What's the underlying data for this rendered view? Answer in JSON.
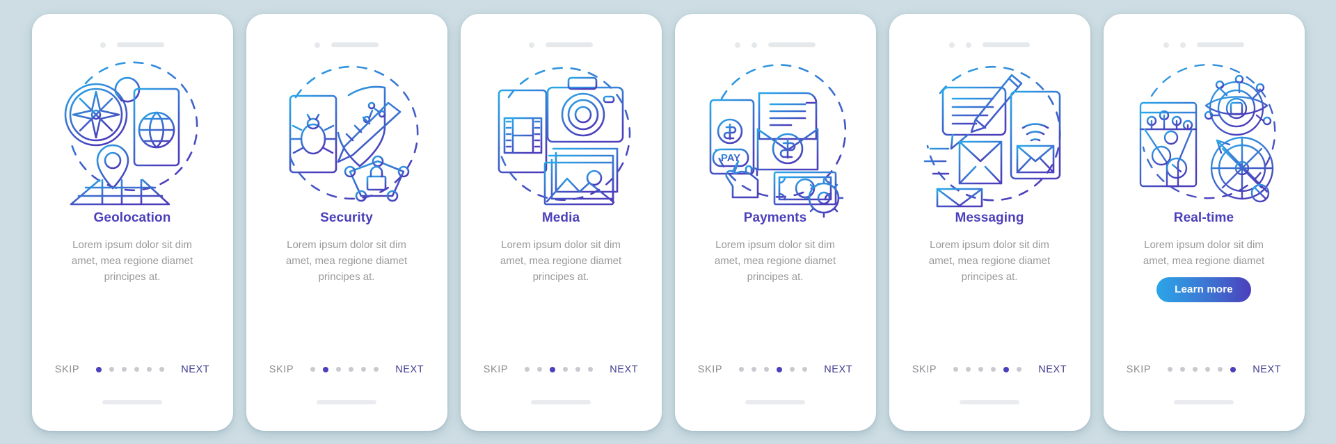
{
  "background_color": "#cddde3",
  "theme": {
    "title_color": "#4b3fbb",
    "desc_color": "#9a9a9d",
    "skip_color": "#8d8d92",
    "next_color": "#3f3a8e",
    "dot_active_color": "#4b3fbb",
    "dot_inactive_color": "#c9c9cf",
    "icon_gradient_from": "#29a8e8",
    "icon_gradient_to": "#4b3fbb",
    "button_gradient_from": "#2ba6e8",
    "button_gradient_to": "#4b3fbb"
  },
  "common": {
    "skip_label": "SKIP",
    "next_label": "NEXT",
    "description": "Lorem ipsum dolor sit dim amet, mea regione diamet principes at.",
    "description_short": "Lorem ipsum dolor sit dim amet, mea regione diamet",
    "dot_count": 6
  },
  "screens": [
    {
      "title": "Geolocation",
      "description": "Lorem ipsum dolor sit dim amet, mea regione diamet principes at.",
      "skip_label": "SKIP",
      "next_label": "NEXT",
      "active_dot": 0,
      "illustration": "geolocation-illustration",
      "icons": [
        "compass-icon",
        "smartphone-globe-icon",
        "map-pin-icon",
        "map-grid-icon"
      ],
      "has_learn_more": false
    },
    {
      "title": "Security",
      "description": "Lorem ipsum dolor sit dim amet, mea regione diamet principes at.",
      "skip_label": "SKIP",
      "next_label": "NEXT",
      "active_dot": 1,
      "illustration": "security-illustration",
      "icons": [
        "smartphone-bug-icon",
        "shield-key-icon",
        "network-lock-icon"
      ],
      "has_learn_more": false
    },
    {
      "title": "Media",
      "description": "Lorem ipsum dolor sit dim amet, mea regione diamet principes at.",
      "skip_label": "SKIP",
      "next_label": "NEXT",
      "active_dot": 2,
      "illustration": "media-illustration",
      "icons": [
        "smartphone-film-icon",
        "camera-icon",
        "photo-stack-icon"
      ],
      "has_learn_more": false
    },
    {
      "title": "Payments",
      "description": "Lorem ipsum dolor sit dim amet, mea regione diamet principes at.",
      "skip_label": "SKIP",
      "next_label": "NEXT",
      "active_dot": 3,
      "illustration": "payments-illustration",
      "icons": [
        "smartphone-pay-icon",
        "invoice-envelope-dollar-icon",
        "banknote-icon",
        "gear-icon",
        "hand-cursor-icon"
      ],
      "has_learn_more": false
    },
    {
      "title": "Messaging",
      "description": "Lorem ipsum dolor sit dim amet, mea regione diamet principes at.",
      "skip_label": "SKIP",
      "next_label": "NEXT",
      "active_dot": 4,
      "illustration": "messaging-illustration",
      "icons": [
        "speech-bubble-pencil-icon",
        "envelope-icon",
        "smartphone-wifi-mail-icon"
      ],
      "has_learn_more": false
    },
    {
      "title": "Real-time",
      "description": "Lorem ipsum dolor sit dim amet, mea regione diamet",
      "skip_label": "SKIP",
      "next_label": "NEXT",
      "active_dot": 5,
      "illustration": "realtime-illustration",
      "icons": [
        "tech-eye-icon",
        "data-funnel-icon",
        "compass-radar-icon"
      ],
      "has_learn_more": true,
      "learn_more_label": "Learn more"
    }
  ]
}
